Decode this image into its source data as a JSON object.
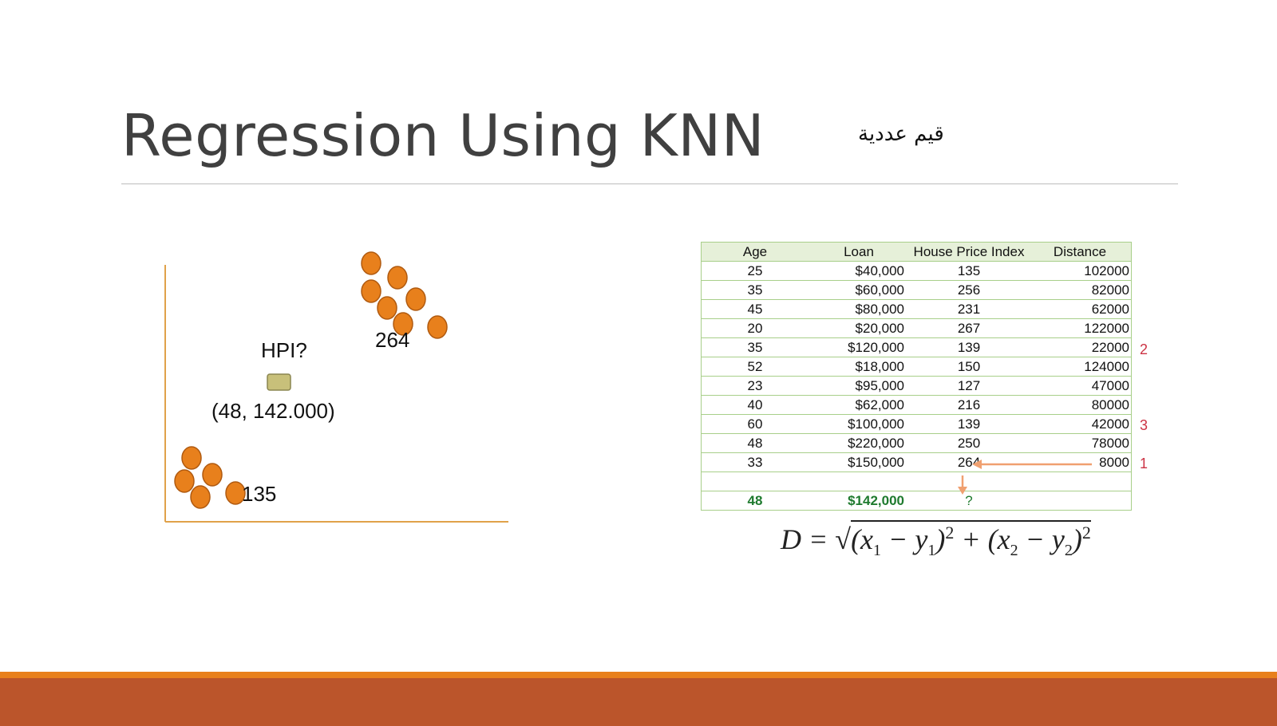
{
  "slide": {
    "title": "Regression Using KNN",
    "note_arabic": "قيم عددية"
  },
  "scatter": {
    "cluster_high_label": "264",
    "cluster_low_label": "135",
    "query_label": "HPI?",
    "query_point": "(48, 142.000)"
  },
  "table": {
    "headers": [
      "Age",
      "Loan",
      "House Price Index",
      "Distance"
    ],
    "rows": [
      [
        "25",
        "$40,000",
        "135",
        "102000"
      ],
      [
        "35",
        "$60,000",
        "256",
        "82000"
      ],
      [
        "45",
        "$80,000",
        "231",
        "62000"
      ],
      [
        "20",
        "$20,000",
        "267",
        "122000"
      ],
      [
        "35",
        "$120,000",
        "139",
        "22000"
      ],
      [
        "52",
        "$18,000",
        "150",
        "124000"
      ],
      [
        "23",
        "$95,000",
        "127",
        "47000"
      ],
      [
        "40",
        "$62,000",
        "216",
        "80000"
      ],
      [
        "60",
        "$100,000",
        "139",
        "42000"
      ],
      [
        "48",
        "$220,000",
        "250",
        "78000"
      ],
      [
        "33",
        "$150,000",
        "264",
        "8000"
      ]
    ],
    "query_row": [
      "48",
      "$142,000",
      "?",
      ""
    ],
    "ranks": [
      "2",
      "3",
      "1"
    ]
  },
  "formula": {
    "lhs": "D",
    "eq": "=",
    "radical": "√",
    "p1": "(x",
    "s1": "1",
    "m1": " − y",
    "s2": "1",
    "p2": ")",
    "e1": "2",
    "plus": " + (x",
    "s3": "2",
    "m2": " − y",
    "s4": "2",
    "p3": ")",
    "e2": "2"
  },
  "colors": {
    "accent_orange": "#e8801c",
    "footer_band": "#bb552b",
    "point_fill": "#e8801c",
    "point_stroke": "#b05a10",
    "query_fill": "#c8c07a",
    "axis": "#e0a24a",
    "rank_red": "#cc3344"
  }
}
